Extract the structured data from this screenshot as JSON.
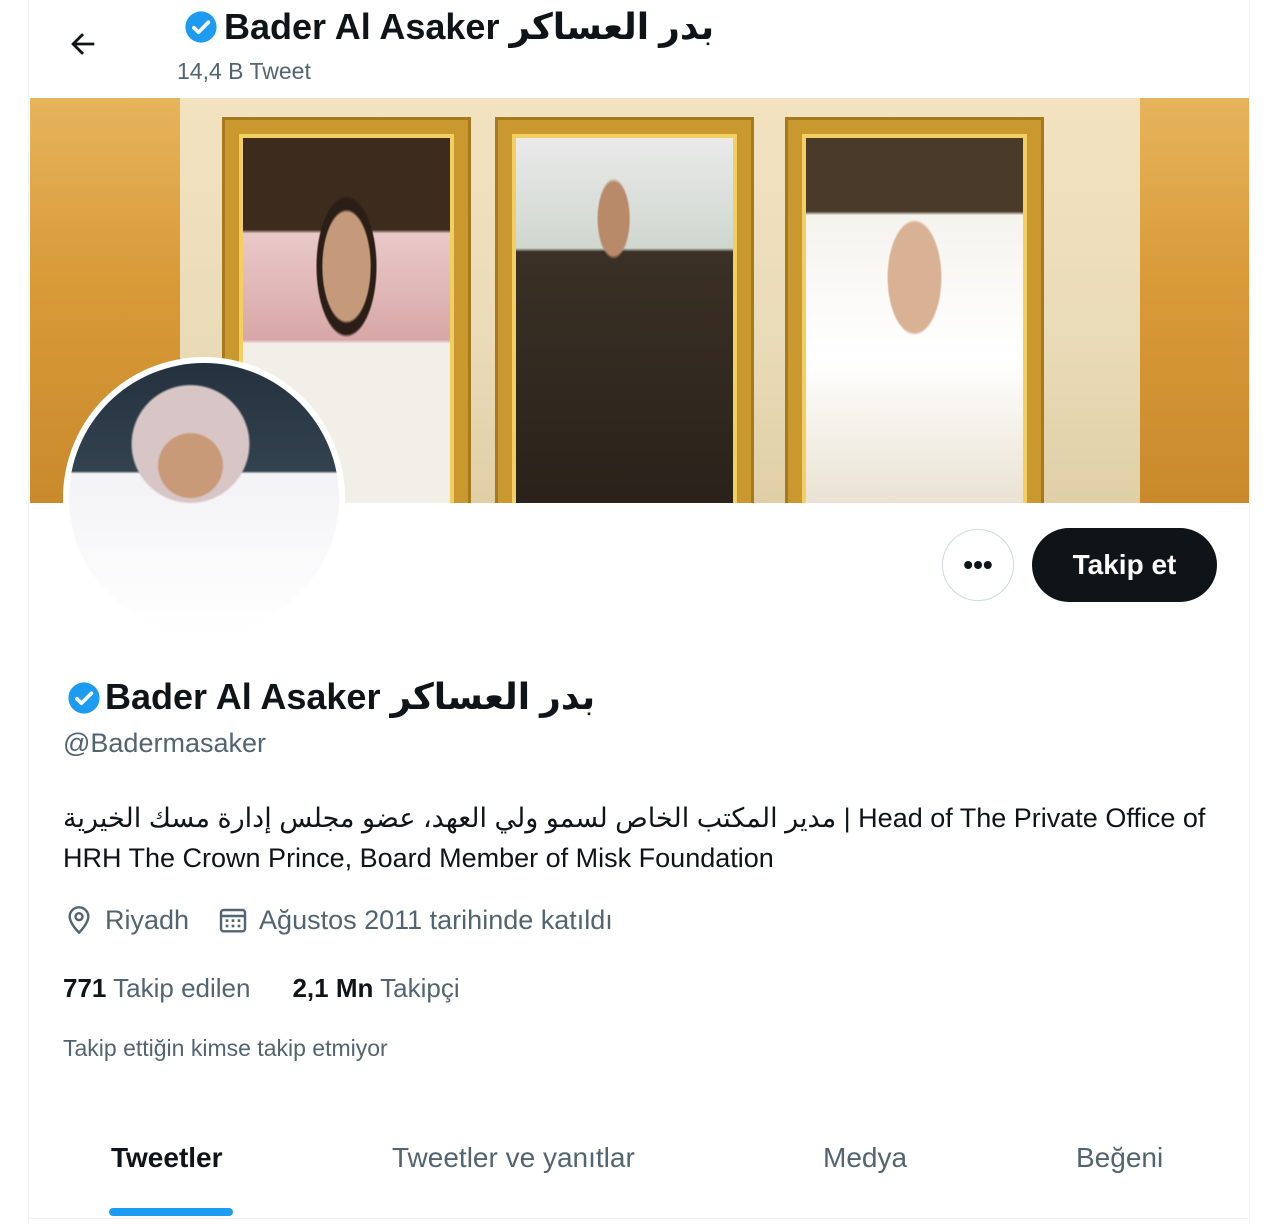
{
  "header": {
    "back_label": "←",
    "name": "Bader Al Asaker بدر العساكر",
    "tweet_count": "14,4 B Tweet"
  },
  "actions": {
    "more_label": "•••",
    "follow_label": "Takip et"
  },
  "profile": {
    "display_name": "Bader Al Asaker بدر العساكر",
    "handle": "@Badermasaker",
    "bio": "مدير المكتب الخاص لسمو ولي العهد، عضو مجلس إدارة مسك الخيرية | Head of The Private Office of HRH The Crown Prince, Board Member of Misk Foundation",
    "location": "Riyadh",
    "joined": "Ağustos 2011 tarihinde katıldı",
    "following_count": "771",
    "following_label": "Takip edilen",
    "followers_count": "2,1 Mn",
    "followers_label": "Takipçi",
    "mutual_note": "Takip ettiğin kimse takip etmiyor"
  },
  "tabs": [
    {
      "label": "Tweetler",
      "active": true
    },
    {
      "label": "Tweetler ve yanıtlar",
      "active": false
    },
    {
      "label": "Medya",
      "active": false
    },
    {
      "label": "Beğeni",
      "active": false
    }
  ],
  "colors": {
    "accent": "#1d9bf0",
    "text_primary": "#0f1419",
    "text_secondary": "#536471",
    "follow_button_bg": "#0f1419"
  },
  "icons": [
    "back-arrow-icon",
    "verified-badge-icon",
    "location-pin-icon",
    "calendar-icon",
    "more-icon"
  ]
}
